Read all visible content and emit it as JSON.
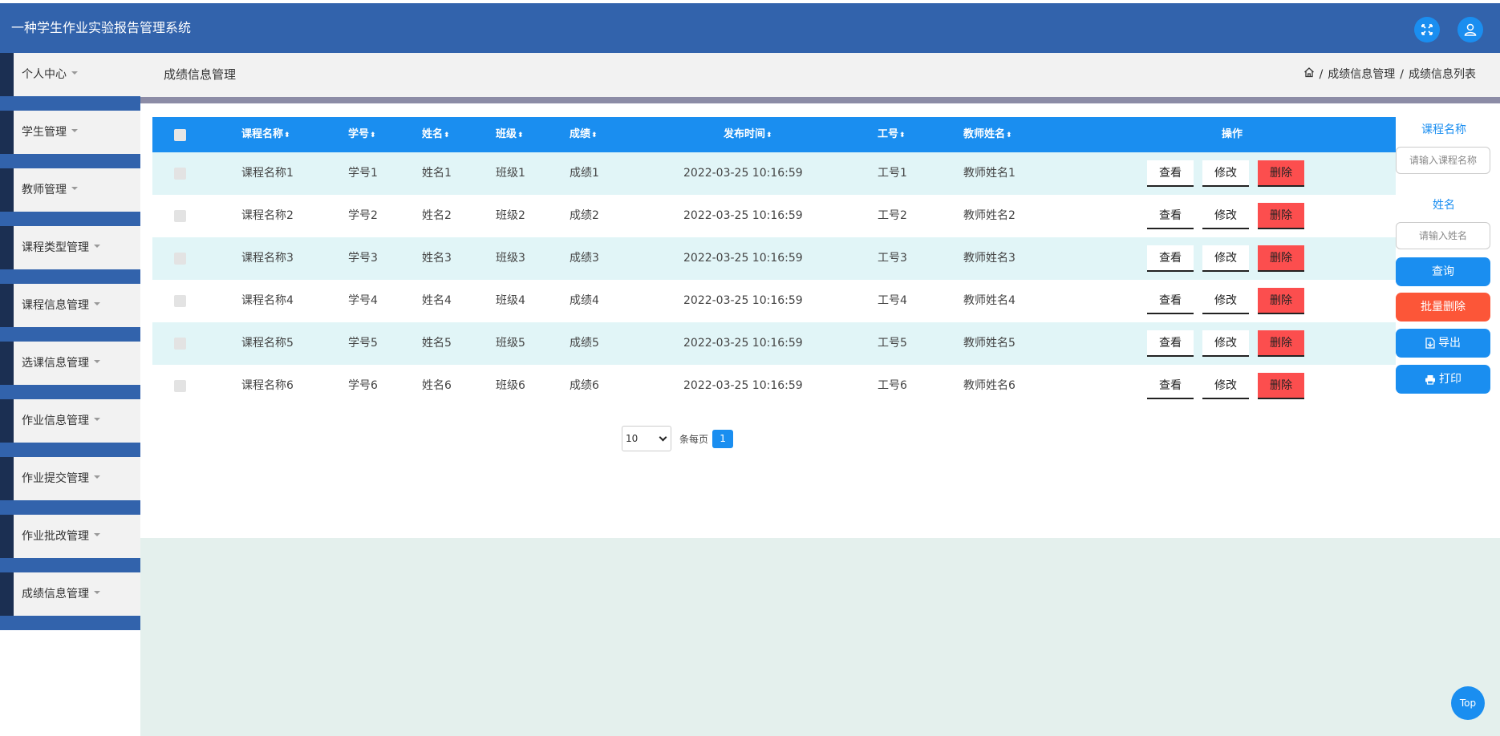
{
  "header": {
    "title": "一种学生作业实验报告管理系统",
    "fullscreen_icon": "fullscreen-icon",
    "user_icon": "user-icon"
  },
  "sidebar": {
    "items": [
      {
        "label": "个人中心"
      },
      {
        "label": "学生管理"
      },
      {
        "label": "教师管理"
      },
      {
        "label": "课程类型管理"
      },
      {
        "label": "课程信息管理"
      },
      {
        "label": "选课信息管理"
      },
      {
        "label": "作业信息管理"
      },
      {
        "label": "作业提交管理"
      },
      {
        "label": "作业批改管理"
      },
      {
        "label": "成绩信息管理"
      }
    ]
  },
  "page": {
    "title": "成绩信息管理",
    "breadcrumb": [
      "成绩信息管理",
      "成绩信息列表"
    ],
    "separator": "/"
  },
  "table": {
    "sort_glyph": "⬍",
    "columns": [
      "课程名称",
      "学号",
      "姓名",
      "班级",
      "成绩",
      "发布时间",
      "工号",
      "教师姓名",
      "操作"
    ],
    "rows": [
      [
        "课程名称1",
        "学号1",
        "姓名1",
        "班级1",
        "成绩1",
        "2022-03-25 10:16:59",
        "工号1",
        "教师姓名1"
      ],
      [
        "课程名称2",
        "学号2",
        "姓名2",
        "班级2",
        "成绩2",
        "2022-03-25 10:16:59",
        "工号2",
        "教师姓名2"
      ],
      [
        "课程名称3",
        "学号3",
        "姓名3",
        "班级3",
        "成绩3",
        "2022-03-25 10:16:59",
        "工号3",
        "教师姓名3"
      ],
      [
        "课程名称4",
        "学号4",
        "姓名4",
        "班级4",
        "成绩4",
        "2022-03-25 10:16:59",
        "工号4",
        "教师姓名4"
      ],
      [
        "课程名称5",
        "学号5",
        "姓名5",
        "班级5",
        "成绩5",
        "2022-03-25 10:16:59",
        "工号5",
        "教师姓名5"
      ],
      [
        "课程名称6",
        "学号6",
        "姓名6",
        "班级6",
        "成绩6",
        "2022-03-25 10:16:59",
        "工号6",
        "教师姓名6"
      ]
    ],
    "actions": {
      "view": "查看",
      "edit": "修改",
      "delete": "删除"
    }
  },
  "pagination": {
    "page_size": "10",
    "per_page_label": "条每页",
    "current_page": "1"
  },
  "search": {
    "course_label": "课程名称",
    "course_placeholder": "请输入课程名称",
    "name_label": "姓名",
    "name_placeholder": "请输入姓名",
    "query": "查询",
    "batch_delete": "批量删除",
    "export": "导出",
    "print": "打印"
  },
  "back_to_top": "Top",
  "colors": {
    "header": "#3263ac",
    "primary": "#1a8ef0",
    "danger": "#fc4e4e",
    "alt_row": "#e1f5f7"
  }
}
